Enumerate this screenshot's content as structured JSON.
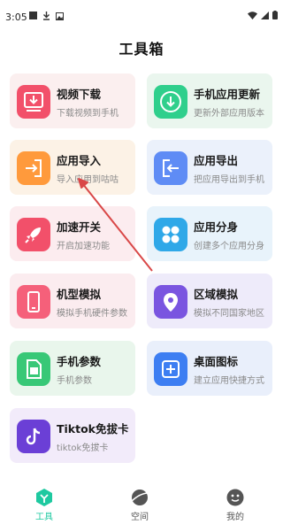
{
  "status": {
    "time": "3:05"
  },
  "header": {
    "title": "工具箱"
  },
  "tools": [
    {
      "title": "视频下载",
      "subtitle": "下载视频到手机",
      "icon": "download-icon"
    },
    {
      "title": "手机应用更新",
      "subtitle": "更新外部应用版本",
      "icon": "update-icon"
    },
    {
      "title": "应用导入",
      "subtitle": "导入应用到咕咕",
      "icon": "import-icon"
    },
    {
      "title": "应用导出",
      "subtitle": "把应用导出到手机",
      "icon": "export-icon"
    },
    {
      "title": "加速开关",
      "subtitle": "开启加速功能",
      "icon": "rocket-icon"
    },
    {
      "title": "应用分身",
      "subtitle": "创建多个应用分身",
      "icon": "clone-icon"
    },
    {
      "title": "机型模拟",
      "subtitle": "模拟手机硬件参数",
      "icon": "phone-icon"
    },
    {
      "title": "区域模拟",
      "subtitle": "模拟不同国家地区",
      "icon": "location-icon"
    },
    {
      "title": "手机参数",
      "subtitle": "手机参数",
      "icon": "sim-card-icon"
    },
    {
      "title": "桌面图标",
      "subtitle": "建立应用快捷方式",
      "icon": "shortcut-icon"
    },
    {
      "title": "Tiktok免拔卡",
      "subtitle": "tiktok免拔卡",
      "icon": "tiktok-icon"
    }
  ],
  "tabbar": {
    "items": [
      {
        "label": "工具",
        "icon": "toolbox-tab-icon",
        "active": true
      },
      {
        "label": "空间",
        "icon": "planet-tab-icon",
        "active": false
      },
      {
        "label": "我的",
        "icon": "profile-tab-icon",
        "active": false
      }
    ]
  },
  "colors": {
    "accent": "#1ec9a0",
    "annotation_arrow": "#d94848",
    "tab_inactive": "#555555"
  }
}
